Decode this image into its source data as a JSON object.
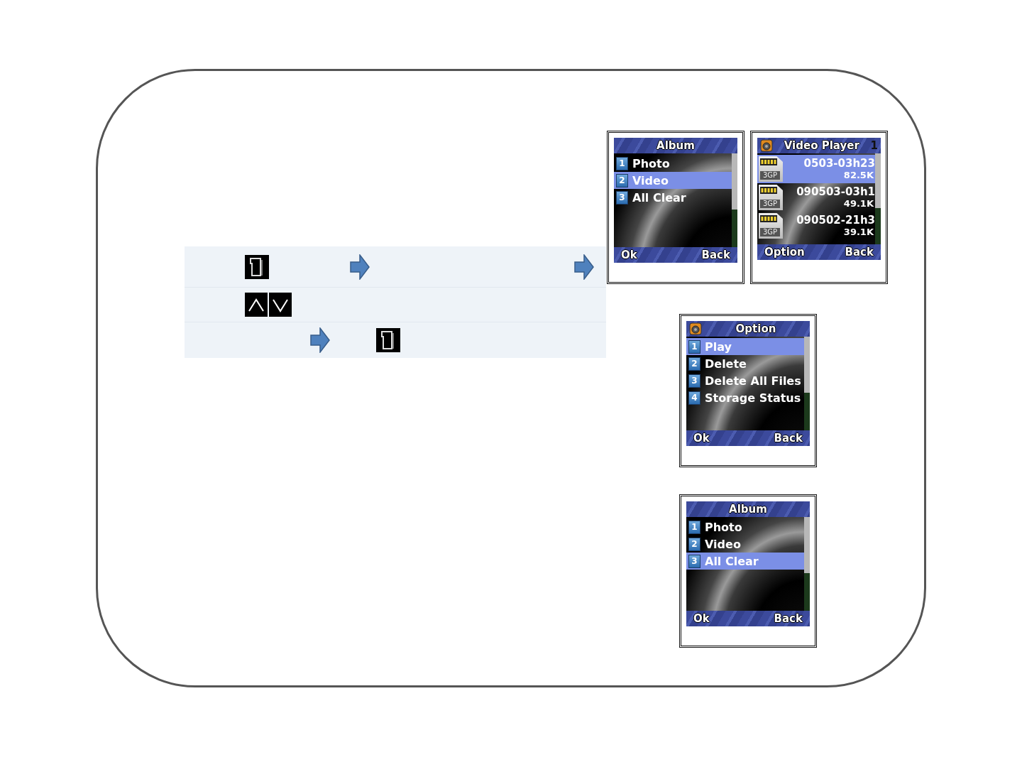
{
  "screens": [
    {
      "kind": "menu",
      "title": "Album",
      "icon": false,
      "items": [
        {
          "number": "1",
          "label": "Photo",
          "selected": false
        },
        {
          "number": "2",
          "label": "Video",
          "selected": true
        },
        {
          "number": "3",
          "label": "All Clear",
          "selected": false
        }
      ],
      "softkeys": {
        "left": "Ok",
        "right": "Back"
      }
    },
    {
      "kind": "files",
      "title": "Video Player",
      "icon": true,
      "counter": "1",
      "files": [
        {
          "badge": "3GP",
          "name": "0503-03h23",
          "size": "82.5K",
          "selected": true
        },
        {
          "badge": "3GP",
          "name": "090503-03h1",
          "size": "49.1K",
          "selected": false
        },
        {
          "badge": "3GP",
          "name": "090502-21h3",
          "size": "39.1K",
          "selected": false
        }
      ],
      "softkeys": {
        "left": "Option",
        "right": "Back"
      }
    },
    {
      "kind": "menu",
      "title": "Option",
      "icon": true,
      "items": [
        {
          "number": "1",
          "label": "Play",
          "selected": true
        },
        {
          "number": "2",
          "label": "Delete",
          "selected": false
        },
        {
          "number": "3",
          "label": "Delete All Files",
          "selected": false
        },
        {
          "number": "4",
          "label": "Storage Status",
          "selected": false
        }
      ],
      "softkeys": {
        "left": "Ok",
        "right": "Back"
      }
    },
    {
      "kind": "menu",
      "title": "Album",
      "icon": false,
      "items": [
        {
          "number": "1",
          "label": "Photo",
          "selected": false
        },
        {
          "number": "2",
          "label": "Video",
          "selected": false
        },
        {
          "number": "3",
          "label": "All Clear",
          "selected": true
        }
      ],
      "softkeys": {
        "left": "Ok",
        "right": "Back"
      }
    }
  ]
}
